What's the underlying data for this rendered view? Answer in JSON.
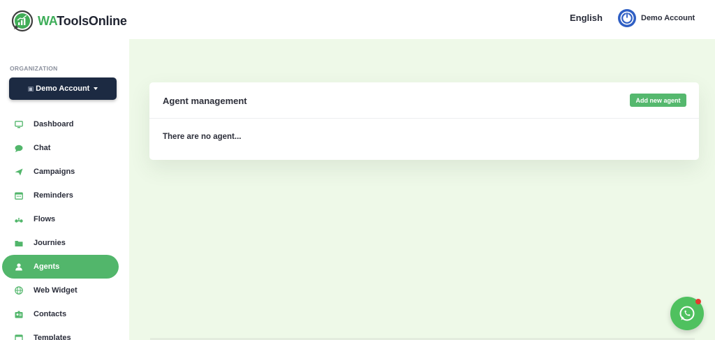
{
  "brand": {
    "name_highlight": "WA",
    "name_rest": "ToolsOnline"
  },
  "header": {
    "language": "English",
    "account_name": "Demo Account"
  },
  "sidebar": {
    "org_label": "ORGANIZATION",
    "org_button": "Demo Account",
    "items": [
      {
        "label": "Dashboard",
        "icon": "monitor-icon",
        "active": false
      },
      {
        "label": "Chat",
        "icon": "chat-bubble-icon",
        "active": false
      },
      {
        "label": "Campaigns",
        "icon": "paper-plane-icon",
        "active": false
      },
      {
        "label": "Reminders",
        "icon": "calendar-icon",
        "active": false
      },
      {
        "label": "Flows",
        "icon": "flow-icon",
        "active": false
      },
      {
        "label": "Journies",
        "icon": "folder-icon",
        "active": false
      },
      {
        "label": "Agents",
        "icon": "user-icon",
        "active": true
      },
      {
        "label": "Web Widget",
        "icon": "globe-icon",
        "active": false
      },
      {
        "label": "Contacts",
        "icon": "contacts-icon",
        "active": false
      },
      {
        "label": "Templates",
        "icon": "template-icon",
        "active": false
      }
    ]
  },
  "main": {
    "card_title": "Agent management",
    "add_button": "Add new agent",
    "empty_text": "There are no agent..."
  },
  "colors": {
    "accent": "#52b66b",
    "org_button_bg": "#1c2a42",
    "main_bg": "#eef9e8",
    "notification": "#e53a2f"
  }
}
